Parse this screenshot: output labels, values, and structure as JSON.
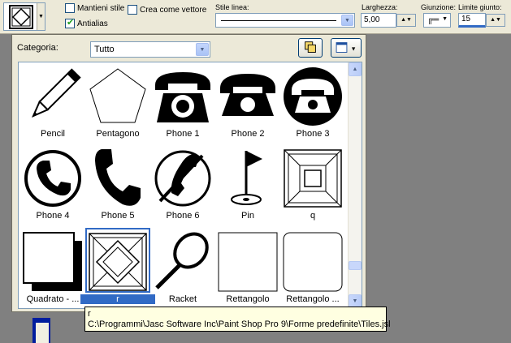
{
  "toolbar": {
    "mantieni_stile": "Mantieni stile",
    "crea_come_vettore": "Crea come vettore",
    "antialias": "Antialias",
    "stile_linea_label": "Stile linea:",
    "larghezza_label": "Larghezza:",
    "larghezza_value": "5,00",
    "giunzione_label": "Giunzione:",
    "limite_giunto_label": "Limite giunto:",
    "limite_giunto_value": "15",
    "checkbox_states": {
      "mantieni_stile": false,
      "crea_come_vettore": false,
      "antialias": true
    }
  },
  "panel": {
    "category_label": "Categoria:",
    "category_value": "Tutto",
    "items": [
      {
        "label": "Pencil",
        "icon": "pencil-icon"
      },
      {
        "label": "Pentagono",
        "icon": "pentagon-icon"
      },
      {
        "label": "Phone 1",
        "icon": "rotary-phone-icon"
      },
      {
        "label": "Phone 2",
        "icon": "desk-phone-icon"
      },
      {
        "label": "Phone 3",
        "icon": "circle-phone-icon"
      },
      {
        "label": "Phone 4",
        "icon": "handset-circle-icon"
      },
      {
        "label": "Phone 5",
        "icon": "handset-icon"
      },
      {
        "label": "Phone 6",
        "icon": "handset-slash-icon"
      },
      {
        "label": "Pin",
        "icon": "golf-pin-icon"
      },
      {
        "label": "q",
        "icon": "square-tile-icon"
      },
      {
        "label": "Quadrato - ...",
        "icon": "square-shadow-icon"
      },
      {
        "label": "r",
        "icon": "diamond-tile-icon"
      },
      {
        "label": "Racket",
        "icon": "racket-icon"
      },
      {
        "label": "Rettangolo",
        "icon": "rectangle-icon"
      },
      {
        "label": "Rettangolo ...",
        "icon": "rounded-rectangle-icon"
      }
    ],
    "selected_index": 11
  },
  "tooltip": {
    "line1": "r",
    "line2": "C:\\Programmi\\Jasc Software Inc\\Paint Shop Pro 9\\Forme predefinite\\Tiles.jsl"
  }
}
